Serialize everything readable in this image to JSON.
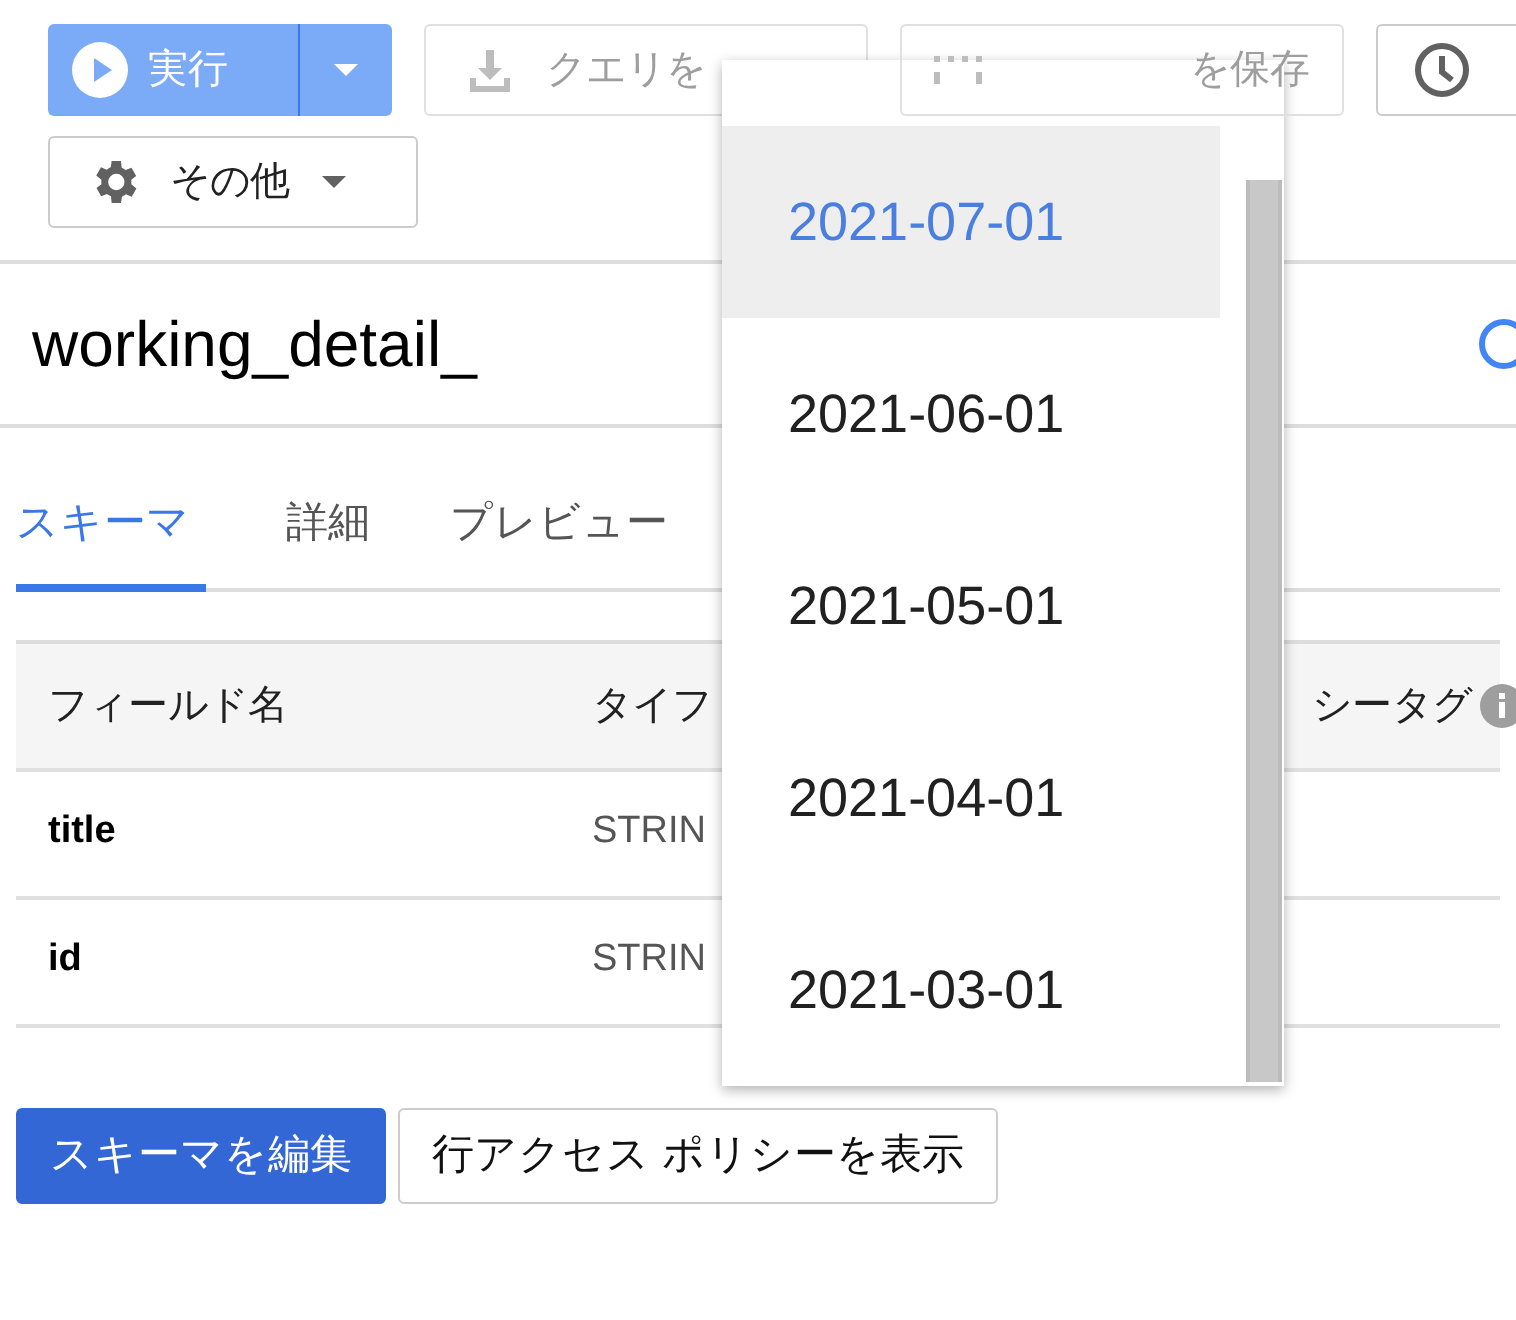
{
  "toolbar": {
    "run_button": {
      "label": "実行"
    },
    "save_query_button": {
      "label": "クエリを",
      "disabled": true
    },
    "save_view_button": {
      "label": "を保存",
      "disabled": true
    },
    "more_button": {
      "label": "その他"
    }
  },
  "title": "working_detail_",
  "tabs": [
    {
      "label": "スキーマ",
      "selected": true
    },
    {
      "label": "詳細",
      "selected": false
    },
    {
      "label": "プレビュー",
      "selected": false
    }
  ],
  "table": {
    "columns": [
      "フィールド名",
      "タイフ",
      "シータグ"
    ],
    "rows": [
      {
        "name": "title",
        "type": "STRIN"
      },
      {
        "name": "id",
        "type": "STRIN"
      }
    ]
  },
  "buttons": [
    {
      "label": "スキーマを編集",
      "kind": "primary"
    },
    {
      "label": "行アクセス ポリシーを表示",
      "kind": "secondary"
    }
  ],
  "dropdown": {
    "items": [
      {
        "label": "2021-07-01",
        "selected": true
      },
      {
        "label": "2021-06-01",
        "selected": false
      },
      {
        "label": "2021-05-01",
        "selected": false
      },
      {
        "label": "2021-04-01",
        "selected": false
      },
      {
        "label": "2021-03-01",
        "selected": false
      }
    ]
  }
}
